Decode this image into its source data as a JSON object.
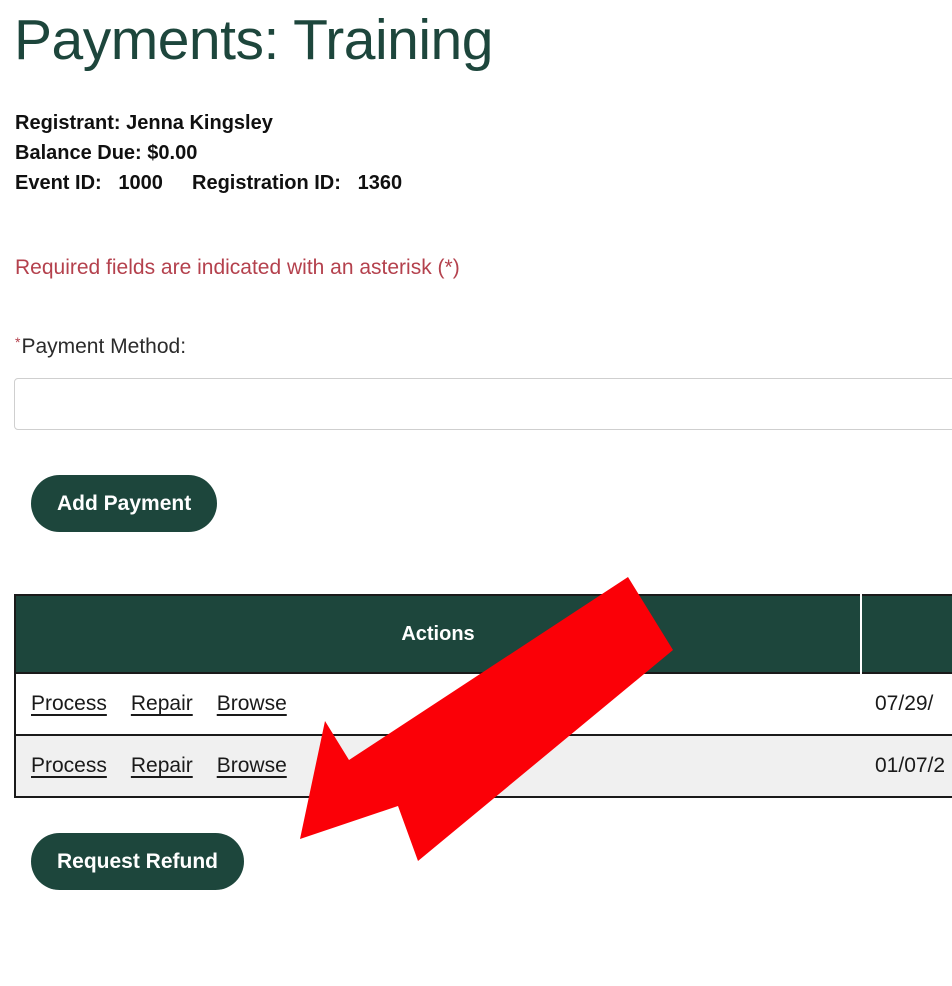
{
  "page": {
    "title": "Payments: Training"
  },
  "summary": {
    "registrant_label": "Registrant:",
    "registrant_value": "Jenna Kingsley",
    "registrant_line": "Registrant: Jenna Kingsley",
    "balance_line": "Balance Due: $0.00",
    "balance_label": "Balance Due:",
    "balance_value": "$0.00",
    "event_id_label": "Event ID:",
    "event_id_value": "1000",
    "registration_id_label": "Registration ID:",
    "registration_id_value": "1360"
  },
  "form": {
    "required_note": "Required fields are indicated with an asterisk (*)",
    "required_marker": "*",
    "payment_method_label": "Payment Method:",
    "payment_method_value": "",
    "payment_method_placeholder": "",
    "chevron_icon": "chevron-down-icon"
  },
  "buttons": {
    "add_payment": "Add Payment",
    "request_refund": "Request Refund"
  },
  "table": {
    "columns": [
      "Actions",
      ""
    ],
    "actions_header": "Actions",
    "date_header": "",
    "rows": [
      {
        "links": [
          "Process",
          "Repair",
          "Browse"
        ],
        "date": "07/29/"
      },
      {
        "links": [
          "Process",
          "Repair",
          "Browse"
        ],
        "date": "01/07/2"
      }
    ]
  },
  "annotation": {
    "arrow_color": "#fb0007",
    "arrow_name": "red-pointer-arrow",
    "points_at": "Request Refund"
  },
  "colors": {
    "brand_green": "#1d463c",
    "required_red": "#b4414d",
    "arrow_red": "#fb0007",
    "row_alt_bg": "#f0f0f0"
  }
}
